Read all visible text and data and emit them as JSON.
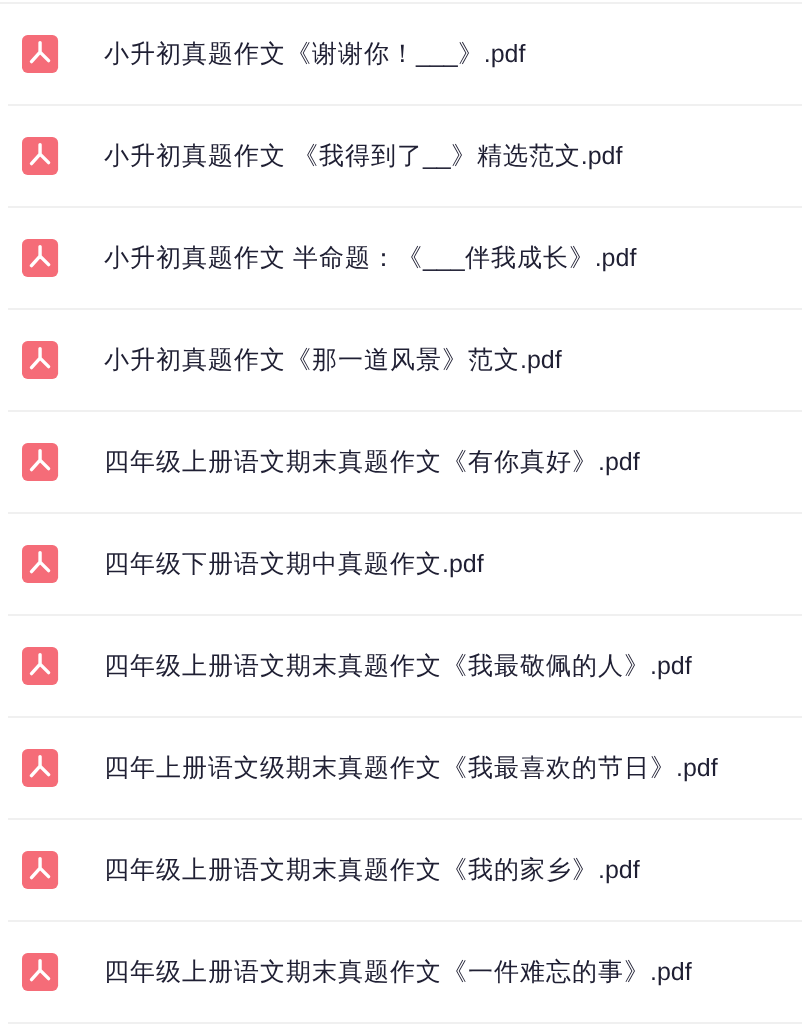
{
  "files": [
    {
      "name": "小升初真题作文《谢谢你！___》.pdf"
    },
    {
      "name": "小升初真题作文 《我得到了__》精选范文.pdf"
    },
    {
      "name": "小升初真题作文 半命题：《___伴我成长》.pdf"
    },
    {
      "name": "小升初真题作文《那一道风景》范文.pdf"
    },
    {
      "name": "四年级上册语文期末真题作文《有你真好》.pdf"
    },
    {
      "name": "四年级下册语文期中真题作文.pdf"
    },
    {
      "name": "四年级上册语文期末真题作文《我最敬佩的人》.pdf"
    },
    {
      "name": "四年上册语文级期末真题作文《我最喜欢的节日》.pdf"
    },
    {
      "name": "四年级上册语文期末真题作文《我的家乡》.pdf"
    },
    {
      "name": "四年级上册语文期末真题作文《一件难忘的事》.pdf"
    }
  ]
}
